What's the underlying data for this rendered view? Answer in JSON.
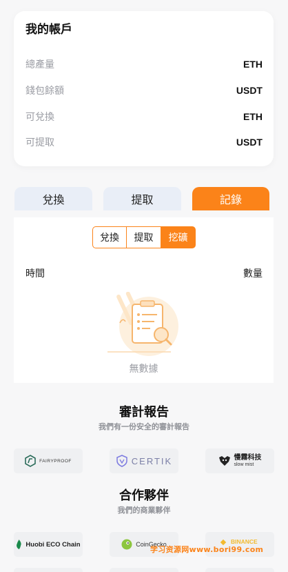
{
  "account": {
    "title": "我的帳戶",
    "rows": [
      {
        "label": "總產量",
        "value": "ETH"
      },
      {
        "label": "錢包餘額",
        "value": "USDT"
      },
      {
        "label": "可兌換",
        "value": "ETH"
      },
      {
        "label": "可提取",
        "value": "USDT"
      }
    ]
  },
  "tabs": [
    {
      "label": "兌換",
      "active": false
    },
    {
      "label": "提取",
      "active": false
    },
    {
      "label": "記錄",
      "active": true
    }
  ],
  "records": {
    "filters": [
      {
        "label": "兌換",
        "active": false
      },
      {
        "label": "提取",
        "active": false
      },
      {
        "label": "挖礦",
        "active": true
      }
    ],
    "columns": {
      "time": "時間",
      "amount": "數量"
    },
    "empty_text": "無數據"
  },
  "audit": {
    "title": "審計報告",
    "subtitle": "我們有一份安全的審計報告",
    "logos": [
      "FAIRYPROOF",
      "CERTIK",
      "慢霧科技",
      "slow mist"
    ]
  },
  "partners": {
    "title": "合作夥伴",
    "subtitle": "我們的商業夥伴",
    "logos": [
      "Huobi ECO Chain",
      "CoinGecko",
      "BINANCE"
    ]
  },
  "watermark": "学习资源网www.bori99.com",
  "colors": {
    "accent": "#fb8319",
    "tab_inactive": "#e9eef7",
    "muted_text": "#9a9ca3"
  }
}
